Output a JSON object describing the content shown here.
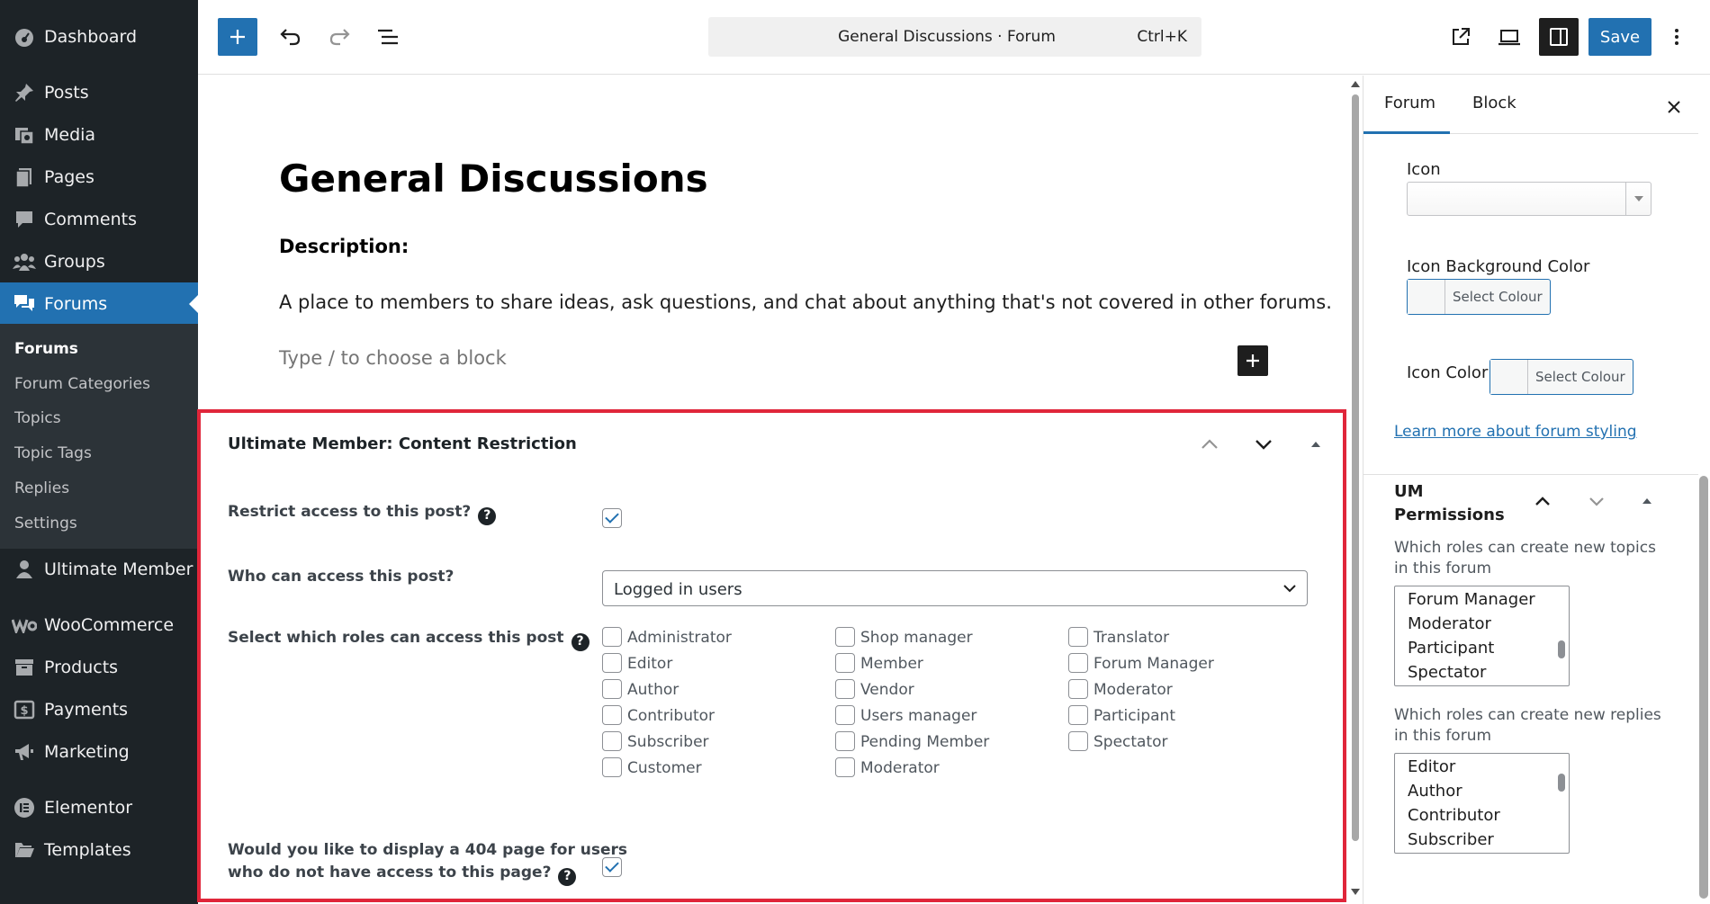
{
  "sidebar": {
    "items": [
      {
        "label": "Dashboard",
        "icon": "dashboard-icon"
      },
      {
        "label": "Posts",
        "icon": "pin-icon"
      },
      {
        "label": "Media",
        "icon": "media-icon"
      },
      {
        "label": "Pages",
        "icon": "pages-icon"
      },
      {
        "label": "Comments",
        "icon": "comments-icon"
      },
      {
        "label": "Groups",
        "icon": "groups-icon"
      },
      {
        "label": "Forums",
        "icon": "forums-icon"
      },
      {
        "label": "Ultimate Member",
        "icon": "user-icon"
      },
      {
        "label": "WooCommerce",
        "icon": "woocommerce-icon"
      },
      {
        "label": "Products",
        "icon": "archive-icon"
      },
      {
        "label": "Payments",
        "icon": "dollar-icon"
      },
      {
        "label": "Marketing",
        "icon": "megaphone-icon"
      },
      {
        "label": "Elementor",
        "icon": "elementor-icon"
      },
      {
        "label": "Templates",
        "icon": "folder-icon"
      }
    ],
    "submenu": [
      "Forums",
      "Forum Categories",
      "Topics",
      "Topic Tags",
      "Replies",
      "Settings"
    ]
  },
  "toolbar": {
    "document_title": "General Discussions · Forum",
    "shortcut": "Ctrl+K",
    "save_label": "Save"
  },
  "editor": {
    "title": "General Discussions",
    "description_label": "Description:",
    "description_text": "A place to members to share ideas, ask questions, and chat about anything that's not covered in other forums.",
    "block_placeholder": "Type / to choose a block"
  },
  "metabox": {
    "title": "Ultimate Member: Content Restriction",
    "restrict_label": "Restrict access to this post?",
    "restrict_checked": true,
    "who_label": "Who can access this post?",
    "who_value": "Logged in users",
    "roles_label": "Select which roles can access this post",
    "roles_col1": [
      "Administrator",
      "Editor",
      "Author",
      "Contributor",
      "Subscriber",
      "Customer"
    ],
    "roles_col2": [
      "Shop manager",
      "Member",
      "Vendor",
      "Users manager",
      "Pending Member",
      "Moderator"
    ],
    "roles_col3": [
      "Translator",
      "Forum Manager",
      "Moderator",
      "Participant",
      "Spectator"
    ],
    "notfound_label_line1": "Would you like to display a 404 page for users",
    "notfound_label_line2": "who do not have access to this page?",
    "notfound_checked": true
  },
  "settings": {
    "tabs": [
      "Forum",
      "Block"
    ],
    "active_tab": "Forum",
    "icon_label": "Icon",
    "icon_bg_label": "Icon Background Color",
    "icon_color_label": "Icon Color",
    "select_colour": "Select Colour",
    "styling_link": "Learn more about forum styling",
    "um_title_line1": "UM",
    "um_title_line2": "Permissions",
    "topics_desc": "Which roles can create new topics in this forum",
    "topics_roles": [
      "Forum Manager",
      "Moderator",
      "Participant",
      "Spectator"
    ],
    "replies_desc": "Which roles can create new replies in this forum",
    "replies_roles": [
      "Editor",
      "Author",
      "Contributor",
      "Subscriber"
    ]
  },
  "colors": {
    "admin_bar": "#1d2327",
    "accent": "#2271b1",
    "highlight_border": "#e0263a"
  }
}
